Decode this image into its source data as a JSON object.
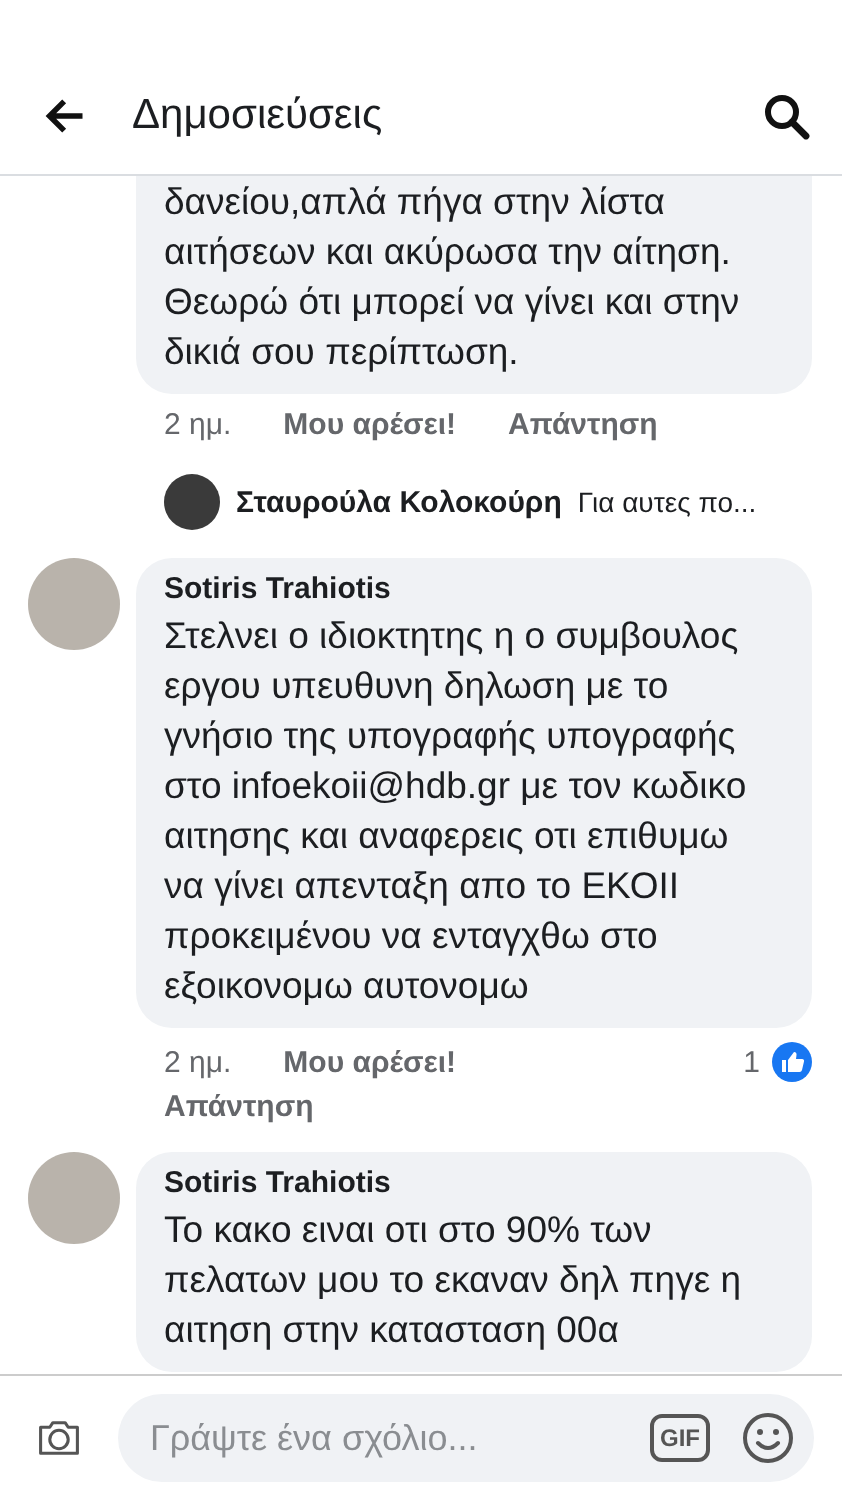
{
  "header": {
    "title": "Δημοσιεύσεις"
  },
  "comments": [
    {
      "text": "δανείου,απλά πήγα στην λίστα\nαιτήσεων και ακύρωσα την αίτηση.\nΘεωρώ ότι μπορεί να γίνει και στην\nδικιά σου περίπτωση.",
      "time": "2 ημ.",
      "like": "Μου αρέσει!",
      "reply": "Απάντηση",
      "reply_preview": {
        "author": "Σταυρούλα Κολοκούρη",
        "text": "Για αυτες πο..."
      }
    },
    {
      "author": "Sotiris Trahiotis",
      "text": "Στελνει ο ιδιοκτητης η ο συμβουλος\nεργου υπευθυνη δηλωση με το\nγνήσιο της υπογραφής υπογραφής\nστο infoekoii@hdb.gr με τον κωδικο\nαιτησης και αναφερεις οτι επιθυμω\nνα γίνει απενταξη απο το ΕΚΟΙΙ\nπροκειμένου να ενταγχθω στο\nεξοικονομω αυτονομω",
      "time": "2 ημ.",
      "like": "Μου αρέσει!",
      "reply": "Απάντηση",
      "likes_count": "1"
    },
    {
      "author": "Sotiris Trahiotis",
      "text": "Το κακο ειναι οτι στο 90% των\nπελατων μου το εκαναν δηλ πηγε η\nαιτηση στην κατασταση 00α"
    }
  ],
  "composer": {
    "placeholder": "Γράψτε ένα σχόλιο...",
    "gif": "GIF"
  }
}
